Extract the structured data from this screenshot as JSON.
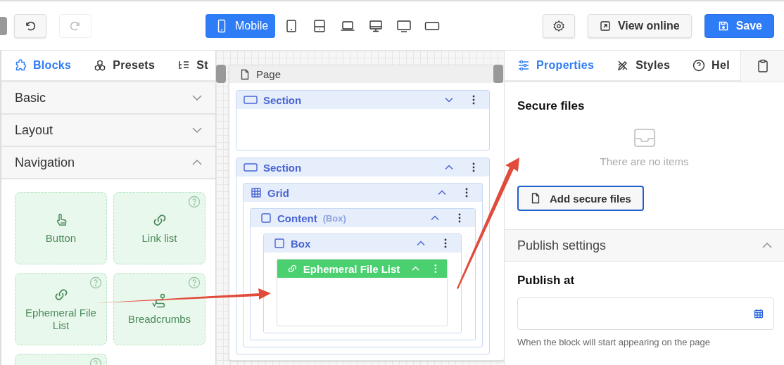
{
  "toolbar": {
    "devices": [
      {
        "kind": "mobile",
        "label": "Mobile",
        "selected": true
      },
      {
        "kind": "tablet",
        "selected": false
      },
      {
        "kind": "tablet-wide",
        "selected": false
      },
      {
        "kind": "laptop",
        "selected": false
      },
      {
        "kind": "desktop",
        "selected": false
      },
      {
        "kind": "monitor",
        "selected": false
      },
      {
        "kind": "wide",
        "selected": false
      }
    ],
    "view_online": "View online",
    "save": "Save"
  },
  "left_tabs": [
    {
      "kind": "blocks",
      "label": "Blocks",
      "selected": true
    },
    {
      "kind": "presets",
      "label": "Presets",
      "selected": false
    },
    {
      "kind": "structure",
      "label": "St",
      "selected": false
    }
  ],
  "categories": [
    {
      "label": "Basic",
      "expanded": false
    },
    {
      "label": "Layout",
      "expanded": false
    },
    {
      "label": "Navigation",
      "expanded": true
    }
  ],
  "blocks": [
    {
      "kind": "pointer",
      "label": "Button",
      "help": false
    },
    {
      "kind": "link",
      "label": "Link list",
      "help": true
    },
    {
      "kind": "link",
      "label": "Ephemeral File List",
      "help": true
    },
    {
      "kind": "route",
      "label": "Breadcrumbs",
      "help": true
    },
    {
      "kind": "none",
      "help": true
    }
  ],
  "page": {
    "title": "Page",
    "children": [
      {
        "kind": "section",
        "label": "Section",
        "expanded": false,
        "selected": false
      },
      {
        "kind": "section",
        "label": "Section",
        "expanded": true,
        "selected": false,
        "children": [
          {
            "kind": "grid",
            "label": "Grid",
            "expanded": true,
            "selected": false,
            "children": [
              {
                "kind": "box",
                "label": "Content",
                "note": "(Box)",
                "expanded": true,
                "selected": false,
                "children": [
                  {
                    "kind": "box",
                    "label": "Box",
                    "expanded": true,
                    "selected": false,
                    "children": [
                      {
                        "kind": "link",
                        "label": "Ephemeral File List",
                        "expanded": true,
                        "selected": true
                      }
                    ]
                  }
                ]
              }
            ]
          }
        ]
      }
    ]
  },
  "right_tabs": [
    {
      "kind": "properties",
      "label": "Properties",
      "selected": true
    },
    {
      "kind": "styles",
      "label": "Styles",
      "selected": false
    },
    {
      "kind": "help",
      "label": "Hel",
      "selected": false
    }
  ],
  "secure_files": {
    "title": "Secure files",
    "empty": "There are no items",
    "button": "Add secure files"
  },
  "publish": {
    "title": "Publish settings",
    "expanded": true,
    "field_label": "Publish at",
    "hint": "When the block will start appearing on the page"
  }
}
